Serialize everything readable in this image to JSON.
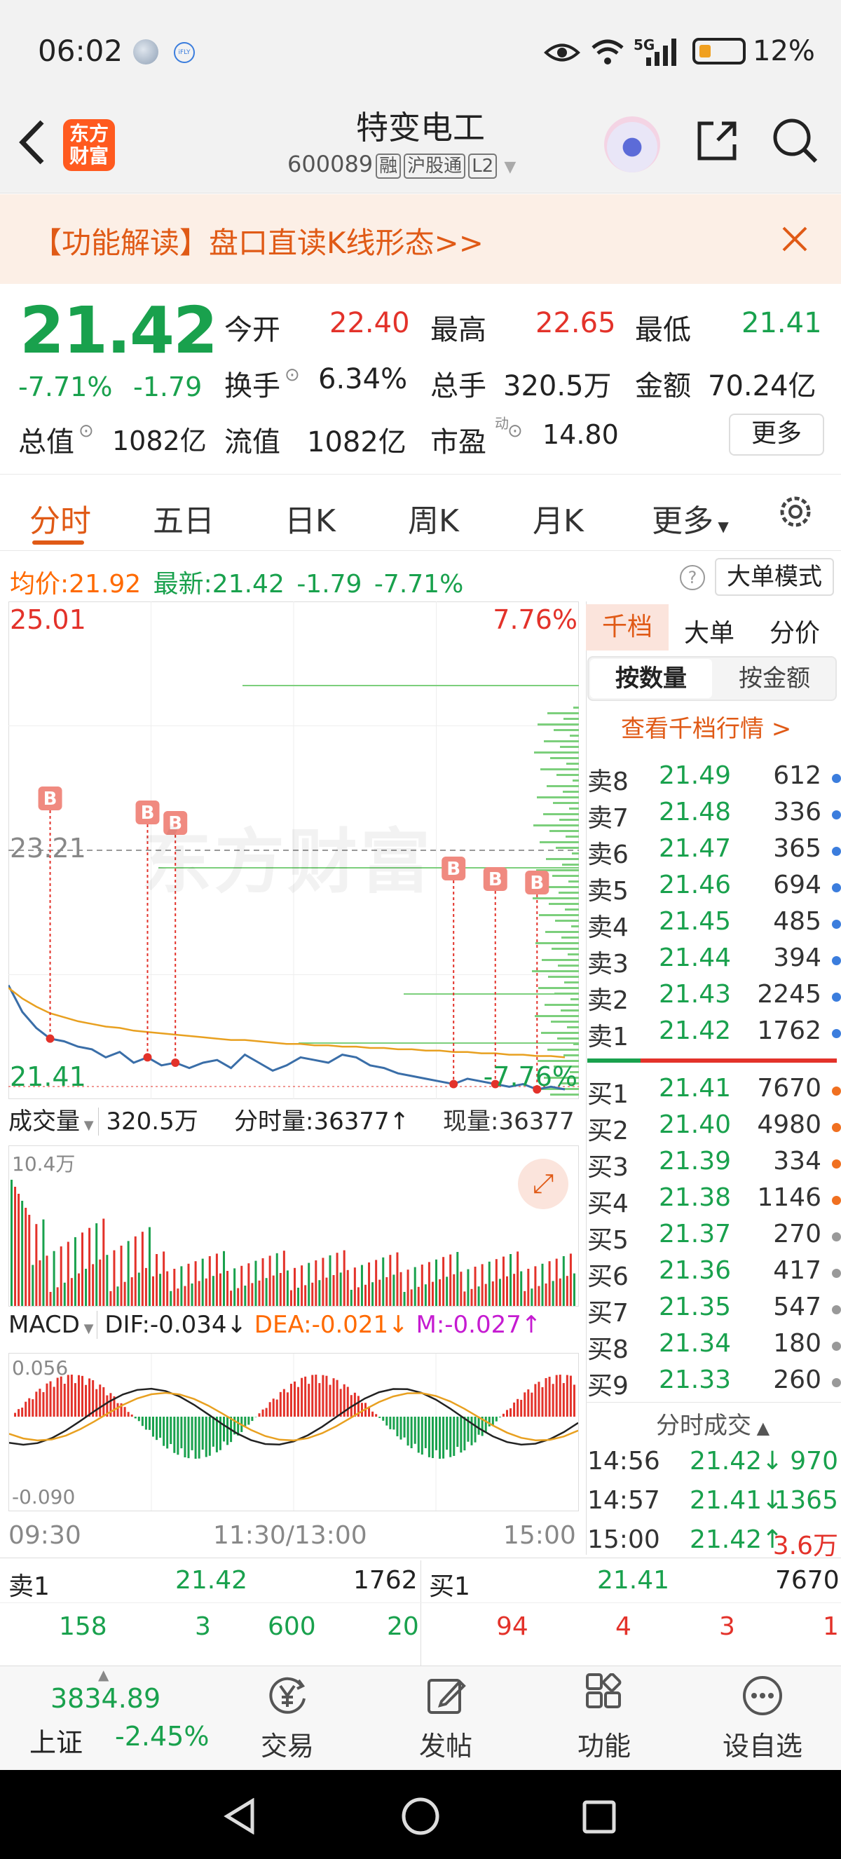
{
  "status_bar": {
    "time": "06:02",
    "network": "5G",
    "battery": "12%"
  },
  "header": {
    "title": "特变电工",
    "code": "600089",
    "tags": [
      "融",
      "沪股通",
      "L2"
    ],
    "logo_text_1": "东方",
    "logo_text_2": "财富"
  },
  "banner": {
    "text": "【功能解读】盘口直读K线形态>>"
  },
  "quote": {
    "price": "21.42",
    "change_pct": "-7.71%",
    "change": "-1.79",
    "open_label": "今开",
    "open": "22.40",
    "high_label": "最高",
    "high": "22.65",
    "low_label": "最低",
    "low": "21.41",
    "turnover_label": "换手",
    "turnover": "6.34%",
    "volume_label": "总手",
    "volume": "320.5万",
    "amount_label": "金额",
    "amount": "70.24亿",
    "mcap_label": "总值",
    "mcap": "1082亿",
    "float_label": "流值",
    "float": "1082亿",
    "pe_label": "市盈",
    "pe_sup": "动",
    "pe": "14.80",
    "more_button": "更多"
  },
  "tabs": [
    "分时",
    "五日",
    "日K",
    "周K",
    "月K",
    "更多"
  ],
  "info_line": {
    "avg_label": "均价:",
    "avg": "21.92",
    "latest_label": "最新:",
    "latest": "21.42",
    "change": "-1.79",
    "pct": "-7.71%",
    "mode_button": "大单模式"
  },
  "chart": {
    "y_top": "25.01",
    "y_mid": "23.21",
    "y_bot": "21.41",
    "pct_top": "7.76%",
    "pct_bot": "-7.76%",
    "watermark": "东方财富",
    "b_marker": "B",
    "vol_label": "成交量",
    "vol_total": "320.5万",
    "tick_vol": "分时量:36377↑",
    "now_vol": "现量:36377",
    "vol_max": "10.4万",
    "macd_label": "MACD",
    "dif": "DIF:-0.034↓",
    "dea": "DEA:-0.021↓",
    "m": "M:-0.027↑",
    "macd_top": "0.056",
    "macd_bot": "-0.090",
    "time_start": "09:30",
    "time_mid": "11:30/13:00",
    "time_end": "15:00"
  },
  "chart_data": {
    "type": "line",
    "title": "",
    "y_range": [
      21.41,
      25.01
    ],
    "pre_close": 23.21,
    "series": [
      {
        "name": "",
        "color": "#3a6ea8",
        "values": [
          22.2,
          22.0,
          21.88,
          21.8,
          21.78,
          21.74,
          21.72,
          21.66,
          21.7,
          21.62,
          21.66,
          21.6,
          21.62,
          21.58,
          21.62,
          21.64,
          21.58,
          21.68,
          21.62,
          21.56,
          21.6,
          21.66,
          21.64,
          21.62,
          21.68,
          21.66,
          21.6,
          21.58,
          21.54,
          21.52,
          21.5,
          21.48,
          21.46,
          21.5,
          21.48,
          21.46,
          21.44,
          21.46,
          21.42,
          21.44,
          21.42
        ]
      },
      {
        "name": "均价",
        "color": "#e8a020",
        "values": [
          22.18,
          22.1,
          22.04,
          21.99,
          21.96,
          21.93,
          21.91,
          21.89,
          21.88,
          21.86,
          21.85,
          21.84,
          21.83,
          21.82,
          21.81,
          21.8,
          21.79,
          21.79,
          21.78,
          21.77,
          21.76,
          21.76,
          21.75,
          21.75,
          21.74,
          21.74,
          21.73,
          21.73,
          21.72,
          21.72,
          21.71,
          21.71,
          21.7,
          21.7,
          21.69,
          21.69,
          21.68,
          21.68,
          21.67,
          21.67,
          21.66
        ]
      }
    ]
  },
  "orderbook": {
    "tabs": [
      "千档",
      "大单",
      "分价"
    ],
    "subtabs": [
      "按数量",
      "按金额"
    ],
    "link": "查看千档行情 >",
    "asks": [
      {
        "label": "卖8",
        "price": "21.49",
        "vol": "612"
      },
      {
        "label": "卖7",
        "price": "21.48",
        "vol": "336"
      },
      {
        "label": "卖6",
        "price": "21.47",
        "vol": "365"
      },
      {
        "label": "卖5",
        "price": "21.46",
        "vol": "694"
      },
      {
        "label": "卖4",
        "price": "21.45",
        "vol": "485"
      },
      {
        "label": "卖3",
        "price": "21.44",
        "vol": "394"
      },
      {
        "label": "卖2",
        "price": "21.43",
        "vol": "2245"
      },
      {
        "label": "卖1",
        "price": "21.42",
        "vol": "1762"
      }
    ],
    "bids": [
      {
        "label": "买1",
        "price": "21.41",
        "vol": "7670"
      },
      {
        "label": "买2",
        "price": "21.40",
        "vol": "4980"
      },
      {
        "label": "买3",
        "price": "21.39",
        "vol": "334"
      },
      {
        "label": "买4",
        "price": "21.38",
        "vol": "1146"
      },
      {
        "label": "买5",
        "price": "21.37",
        "vol": "270"
      },
      {
        "label": "买6",
        "price": "21.36",
        "vol": "417"
      },
      {
        "label": "买7",
        "price": "21.35",
        "vol": "547"
      },
      {
        "label": "买8",
        "price": "21.34",
        "vol": "180"
      },
      {
        "label": "买9",
        "price": "21.33",
        "vol": "260"
      }
    ],
    "trades_title": "分时成交",
    "trades": [
      {
        "time": "14:56",
        "price": "21.42↓",
        "vol": "970"
      },
      {
        "time": "14:57",
        "price": "21.41↓",
        "vol": "1365"
      },
      {
        "time": "15:00",
        "price": "21.42↑",
        "vol": "3.6万"
      }
    ]
  },
  "queue": {
    "sell_label": "卖1",
    "sell_price": "21.42",
    "sell_vol": "1762",
    "buy_label": "买1",
    "buy_price": "21.41",
    "buy_vol": "7670",
    "sell_items": [
      "158",
      "3",
      "600",
      "20"
    ],
    "buy_items": [
      "94",
      "4",
      "3",
      "1"
    ]
  },
  "bottom": {
    "index_value": "3834.89",
    "index_name": "上证",
    "index_pct": "-2.45%",
    "trade": "交易",
    "post": "发帖",
    "func": "功能",
    "watch": "设自选"
  }
}
